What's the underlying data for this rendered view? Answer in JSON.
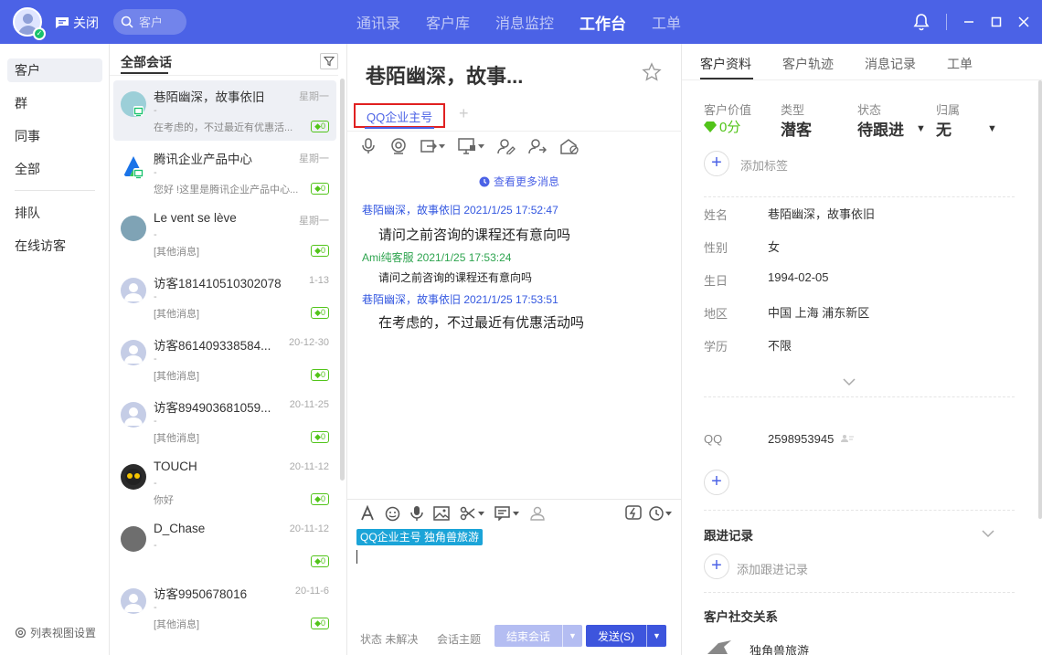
{
  "topbar": {
    "close_label": "关闭",
    "search_placeholder": "客户",
    "nav": [
      "通讯录",
      "客户库",
      "消息监控",
      "工作台",
      "工单"
    ],
    "active_nav": "工作台"
  },
  "leftnav": {
    "items": [
      "客户",
      "群",
      "同事",
      "全部"
    ],
    "items2": [
      "排队",
      "在线访客"
    ],
    "settings_label": "列表视图设置"
  },
  "conversations": {
    "header": "全部会话",
    "items": [
      {
        "name": "巷陌幽深，故事依旧",
        "date": "星期一",
        "dash": "-",
        "preview": "在考虑的，不过最近有优惠活...",
        "badge": "0",
        "avatar_color": "#9ccfd8"
      },
      {
        "name": "腾讯企业产品中心",
        "date": "星期一",
        "dash": "-",
        "preview": "您好 !这里是腾讯企业产品中心...",
        "badge": "0",
        "avatar_color": "#ffffff"
      },
      {
        "name": "Le vent se lève",
        "date": "星期一",
        "dash": "-",
        "preview": "[其他消息]",
        "badge": "0",
        "avatar_color": "#7fa3b5"
      },
      {
        "name": "访客181410510302078",
        "date": "1-13",
        "dash": "-",
        "preview": "[其他消息]",
        "badge": "0",
        "avatar_color": "#c5cde6"
      },
      {
        "name": "访客861409338584...",
        "date": "20-12-30",
        "dash": "-",
        "preview": "[其他消息]",
        "badge": "0",
        "avatar_color": "#c5cde6"
      },
      {
        "name": "访客894903681059...",
        "date": "20-11-25",
        "dash": "-",
        "preview": "[其他消息]",
        "badge": "0",
        "avatar_color": "#c5cde6"
      },
      {
        "name": "TOUCH",
        "date": "20-11-12",
        "dash": "-",
        "preview": "你好",
        "badge": "0",
        "avatar_color": "#2b2b2b"
      },
      {
        "name": "D_Chase",
        "date": "20-11-12",
        "dash": "-",
        "preview": "",
        "badge": "0",
        "avatar_color": "#6e6e6e"
      },
      {
        "name": "访客9950678016",
        "date": "20-11-6",
        "dash": "-",
        "preview": "[其他消息]",
        "badge": "0",
        "avatar_color": "#c5cde6"
      }
    ]
  },
  "chat": {
    "title": "巷陌幽深，故事...",
    "tab_label": "QQ企业主号",
    "more_label": "查看更多消息",
    "messages": [
      {
        "sender": "巷陌幽深，故事依旧 2021/1/25 17:52:47",
        "text": "请问之前咨询的课程还有意向吗",
        "role": "cust",
        "size": "big"
      },
      {
        "sender": "Ami纯客服 2021/1/25 17:53:24",
        "text": "请问之前咨询的课程还有意向吗",
        "role": "agent",
        "size": "small"
      },
      {
        "sender": "巷陌幽深，故事依旧 2021/1/25 17:53:51",
        "text": "在考虑的，不过最近有优惠活动吗",
        "role": "cust",
        "size": "big"
      }
    ],
    "input_tag": "QQ企业主号 独角兽旅游",
    "status_label": "状态",
    "status_value": "未解决",
    "topic_label": "会话主题",
    "end_label": "结束会话",
    "send_label": "发送(S)"
  },
  "customer": {
    "tabs": [
      "客户资料",
      "客户轨迹",
      "消息记录",
      "工单"
    ],
    "value_label": "客户价值",
    "value": "0分",
    "type_label": "类型",
    "type_value": "潜客",
    "status_label": "状态",
    "status_value": "待跟进",
    "owner_label": "归属",
    "owner_value": "无",
    "add_tag_label": "添加标签",
    "fields": [
      {
        "label": "姓名",
        "value": "巷陌幽深，故事依旧"
      },
      {
        "label": "性别",
        "value": "女"
      },
      {
        "label": "生日",
        "value": "1994-02-05"
      },
      {
        "label": "地区",
        "value": "中国 上海 浦东新区"
      },
      {
        "label": "学历",
        "value": "不限"
      }
    ],
    "qq_label": "QQ",
    "qq_value": "2598953945",
    "followup_title": "跟进记录",
    "add_followup_label": "添加跟进记录",
    "social_title": "客户社交关系",
    "social_item": "独角兽旅游"
  },
  "colors": {
    "brand": "#4b62e6",
    "badge_green": "#52c41a",
    "tag_blue": "#1ba4d8"
  }
}
